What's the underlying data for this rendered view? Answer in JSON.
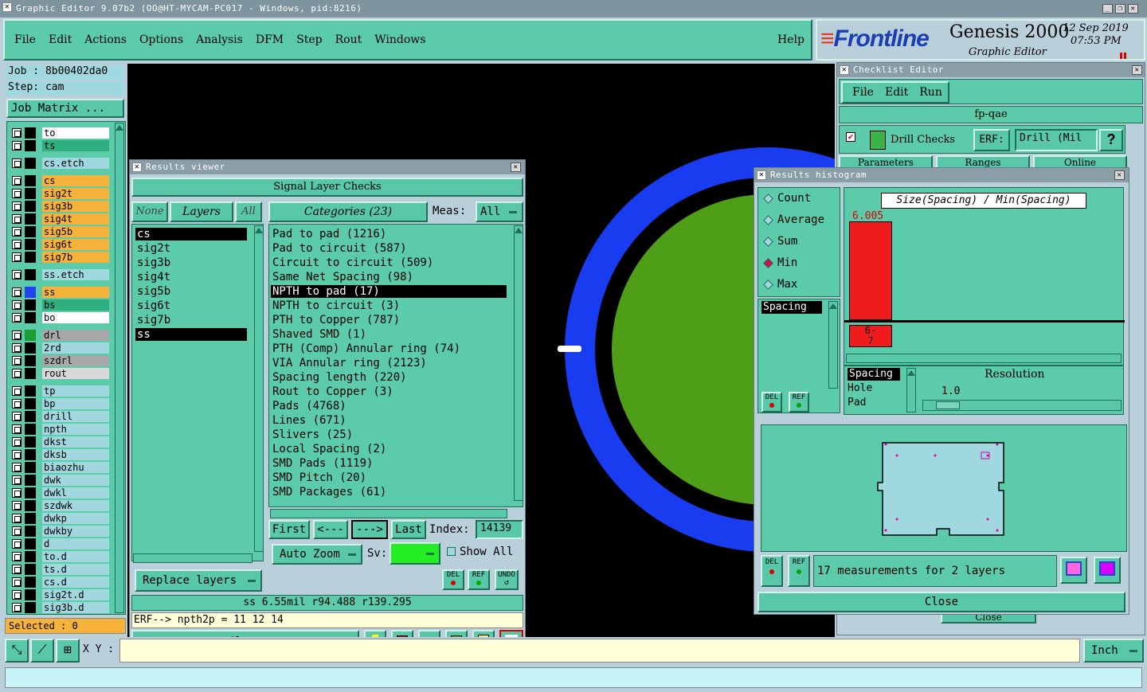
{
  "app": {
    "title": "Graphic Editor 9.07b2 (OO@HT-MYCAM-PC017 - Windows, pid:8216)",
    "menu": [
      "File",
      "Edit",
      "Actions",
      "Options",
      "Analysis",
      "DFM",
      "Step",
      "Rout",
      "Windows"
    ],
    "help": "Help",
    "brand": "Frontline",
    "product": "Genesis 2000",
    "subtitle": "Graphic Editor",
    "date": "12  Sep  2019",
    "time": "07:53  PM"
  },
  "left": {
    "job": "Job : 8b00402da0",
    "step": "Step: cam",
    "job_matrix": "Job Matrix ...",
    "selected": "Selected : 0",
    "xy": "X Y :",
    "layers": [
      {
        "name": "to",
        "color": "#ffffff",
        "group": 1
      },
      {
        "name": "ts",
        "color": "#2fae80",
        "group": 1
      },
      {
        "name": "cs.etch",
        "color": "#9fd8de",
        "group": 2
      },
      {
        "name": "cs",
        "color": "#f5b33c",
        "group": 3
      },
      {
        "name": "sig2t",
        "color": "#f5b33c",
        "group": 3
      },
      {
        "name": "sig3b",
        "color": "#f5b33c",
        "group": 3
      },
      {
        "name": "sig4t",
        "color": "#f5b33c",
        "group": 3
      },
      {
        "name": "sig5b",
        "color": "#f5b33c",
        "group": 3
      },
      {
        "name": "sig6t",
        "color": "#f5b33c",
        "group": 3
      },
      {
        "name": "sig7b",
        "color": "#f5b33c",
        "group": 3
      },
      {
        "name": "ss.etch",
        "color": "#9fd8de",
        "group": 4
      },
      {
        "name": "ss",
        "color": "#f5b33c",
        "group": 5
      },
      {
        "name": "bs",
        "color": "#2fae80",
        "group": 5
      },
      {
        "name": "bo",
        "color": "#ffffff",
        "group": 5
      },
      {
        "name": "drl",
        "color": "#a8a8a8",
        "group": 6
      },
      {
        "name": "2rd",
        "color": "#9fd8de",
        "group": 6
      },
      {
        "name": "szdrl",
        "color": "#a8a8a8",
        "group": 6
      },
      {
        "name": "rout",
        "color": "#d8d8d8",
        "group": 6
      },
      {
        "name": "tp",
        "color": "#9fd8de",
        "group": 7
      },
      {
        "name": "bp",
        "color": "#9fd8de",
        "group": 7
      },
      {
        "name": "drill",
        "color": "#9fd8de",
        "group": 7
      },
      {
        "name": "npth",
        "color": "#9fd8de",
        "group": 7
      },
      {
        "name": "dkst",
        "color": "#9fd8de",
        "group": 7
      },
      {
        "name": "dksb",
        "color": "#9fd8de",
        "group": 7
      },
      {
        "name": "biaozhu",
        "color": "#9fd8de",
        "group": 7
      },
      {
        "name": "dwk",
        "color": "#9fd8de",
        "group": 7
      },
      {
        "name": "dwkl",
        "color": "#9fd8de",
        "group": 7
      },
      {
        "name": "szdwk",
        "color": "#9fd8de",
        "group": 7
      },
      {
        "name": "dwkp",
        "color": "#9fd8de",
        "group": 7
      },
      {
        "name": "dwkby",
        "color": "#9fd8de",
        "group": 7
      },
      {
        "name": "d",
        "color": "#9fd8de",
        "group": 7
      },
      {
        "name": "to.d",
        "color": "#9fd8de",
        "group": 7
      },
      {
        "name": "ts.d",
        "color": "#9fd8de",
        "group": 7
      },
      {
        "name": "cs.d",
        "color": "#9fd8de",
        "group": 7
      },
      {
        "name": "sig2t.d",
        "color": "#9fd8de",
        "group": 7
      },
      {
        "name": "sig3b.d",
        "color": "#9fd8de",
        "group": 7
      }
    ]
  },
  "results_viewer": {
    "title": "Results viewer",
    "header": "Signal Layer Checks",
    "none": "None",
    "layers_btn": "Layers",
    "all": "All",
    "categories_btn": "Categories (23)",
    "meas_label": "Meas:",
    "meas_value": "All",
    "layer_list": [
      "cs",
      "sig2t",
      "sig3b",
      "sig4t",
      "sig5b",
      "sig6t",
      "sig7b",
      "ss"
    ],
    "categories": [
      "Pad to pad (1216)",
      "Pad to circuit (587)",
      "Circuit to circuit (509)",
      "Same Net Spacing (98)",
      "NPTH to pad (17)",
      "NPTH to circuit (3)",
      "PTH to Copper (787)",
      "Shaved SMD (1)",
      "PTH (Comp) Annular ring (74)",
      "VIA Annular ring (2123)",
      "Spacing length (220)",
      "Rout to Copper (3)",
      "Pads (4768)",
      "Lines (671)",
      "Slivers (25)",
      "Local Spacing (2)",
      "SMD Pads (1119)",
      "SMD Pitch (20)",
      "SMD Packages (61)"
    ],
    "selected_category": 4,
    "first": "First",
    "prev": "<---",
    "next": "--->",
    "last": "Last",
    "index_label": "Index:",
    "index_value": "14139",
    "auto_zoom": "Auto Zoom",
    "sv": "Sv:",
    "show_all": "Show All",
    "replace_layers": "Replace layers",
    "del": "DEL",
    "ref": "REF",
    "undo": "UNDO",
    "status": "ss 6.55mil  r94.488  r139.295",
    "erf": "ERF--> npth2p = 11 12 14",
    "close": "Close"
  },
  "checklist": {
    "title": "Checklist Editor",
    "menu": [
      "File",
      "Edit",
      "Run"
    ],
    "name": "fp-qae",
    "drill_checks": "Drill Checks",
    "erf": "ERF:",
    "erf_value": "Drill (Mil",
    "help": "?",
    "tabs": [
      "Parameters",
      "Ranges",
      "Online"
    ],
    "close": "Close"
  },
  "histogram": {
    "title": "Results histogram",
    "options": [
      "Count",
      "Average",
      "Sum",
      "Min",
      "Max"
    ],
    "selected_option": 3,
    "list": [
      "Spacing"
    ],
    "chart_title": "Size(Spacing) / Min(Spacing)",
    "bar_value": "6.005",
    "bin_label": "6-7",
    "res_list": [
      "Spacing",
      "Hole",
      "Pad"
    ],
    "resolution_label": "Resolution",
    "resolution_value": "1.0",
    "measurements": "17 measurements for 2 layers",
    "close": "Close",
    "del": "DEL",
    "ref": "REF"
  },
  "bottom": {
    "units": "Inch"
  }
}
